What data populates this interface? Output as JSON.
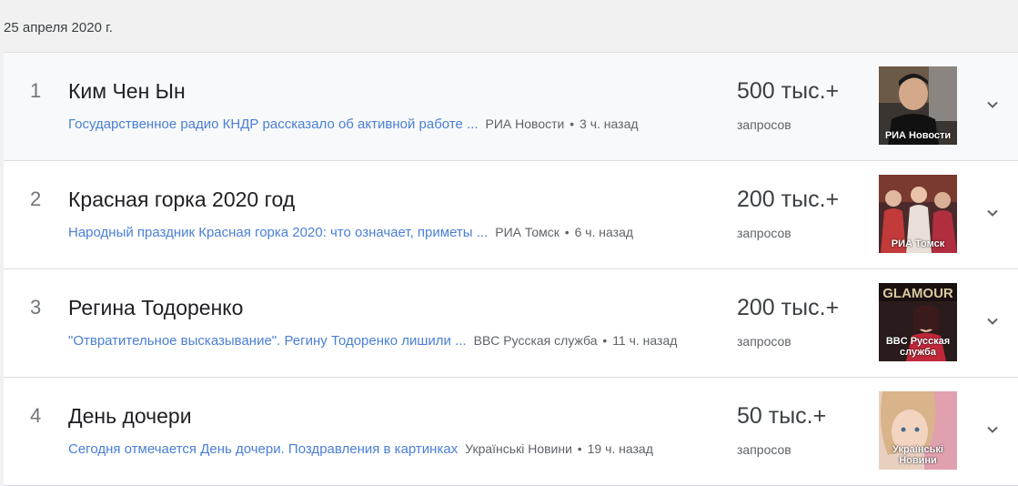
{
  "date": "25 апреля 2020 г.",
  "items": [
    {
      "rank": "1",
      "title": "Ким Чен Ын",
      "article": "Государственное радио КНДР рассказало об активной работе ...",
      "source": "РИА Новости",
      "age": "3 ч. назад",
      "count": "500 тыс.+",
      "count_label": "запросов",
      "thumb_label": "РИА Новости",
      "expand_icon": "chevron-down-icon"
    },
    {
      "rank": "2",
      "title": "Красная горка 2020 год",
      "article": "Народный праздник Красная горка 2020: что означает, приметы ...",
      "source": "РИА Томск",
      "age": "6 ч. назад",
      "count": "200 тыс.+",
      "count_label": "запросов",
      "thumb_label": "РИА Томск",
      "expand_icon": "chevron-down-icon"
    },
    {
      "rank": "3",
      "title": "Регина Тодоренко",
      "article": "\"Отвратительное высказывание\". Регину Тодоренко лишили ...",
      "source": "BBC Русская служба",
      "age": "11 ч. назад",
      "count": "200 тыс.+",
      "count_label": "запросов",
      "thumb_label": "BBC Русская служба",
      "thumb_text": "GLAMOUR",
      "expand_icon": "chevron-down-icon"
    },
    {
      "rank": "4",
      "title": "День дочери",
      "article": "Сегодня отмечается День дочери. Поздравления в картинках",
      "source": "Українські Новини",
      "age": "19 ч. назад",
      "count": "50 тыс.+",
      "count_label": "запросов",
      "thumb_label": "Українські Новини",
      "expand_icon": "chevron-down-icon"
    }
  ]
}
